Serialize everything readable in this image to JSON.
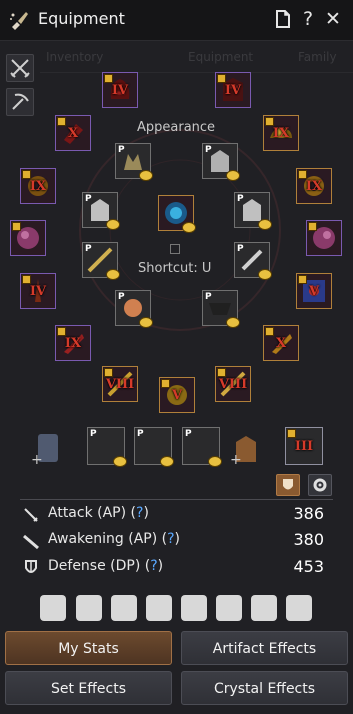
{
  "window": {
    "title": "Equipment",
    "icon": "brush-icon",
    "controls": [
      "document-icon",
      "help-icon",
      "close-icon"
    ],
    "help_glyph": "?",
    "close_glyph": "✕"
  },
  "background_tabs": [
    "Inventory",
    "",
    "Equipment",
    "Family"
  ],
  "labels": {
    "appearance": "Appearance",
    "shortcut": "Shortcut: U"
  },
  "slots": {
    "top_left": {
      "enhancement": "IV"
    },
    "top_right": {
      "enhancement": "IV"
    },
    "upper_left": {
      "enhancement": "X"
    },
    "upper_right": {
      "enhancement": "IX"
    },
    "mid_left": {
      "enhancement": "IX"
    },
    "mid_right": {
      "enhancement": "IX"
    },
    "low_left": {
      "enhancement": "IV"
    },
    "low_right": {
      "enhancement": "V"
    },
    "lower_left": {
      "enhancement": "IX"
    },
    "lower_right": {
      "enhancement": "X"
    },
    "bottom_left": {
      "enhancement": "VIII"
    },
    "bottom_center": {
      "enhancement": "V"
    },
    "bottom_right": {
      "enhancement": "VIII"
    },
    "tool_slot": {
      "enhancement": "III"
    }
  },
  "pet_marker": "+",
  "stats": [
    {
      "name": "Attack (AP)",
      "help": "?",
      "value": "386",
      "icon": "sword-icon"
    },
    {
      "name": "Awakening (AP)",
      "help": "?",
      "value": "380",
      "icon": "awakening-sword-icon"
    },
    {
      "name": "Defense (DP)",
      "help": "?",
      "value": "453",
      "icon": "shield-icon"
    }
  ],
  "life_skill_icons": [
    "gathering-icon",
    "fishing-icon",
    "hunting-icon",
    "training-icon",
    "trading-icon",
    "farming-icon",
    "sailing-icon",
    "defense-icon"
  ],
  "buttons": {
    "my_stats": "My Stats",
    "artifact_effects": "Artifact Effects",
    "set_effects": "Set Effects",
    "crystal_effects": "Crystal Effects"
  },
  "colors": {
    "accent_active": "#6c4a2e",
    "enhancement_text": "#d63a2a",
    "help_blue": "#5aa8ff",
    "slot_border_purple": "#7a5ab0",
    "slot_border_gold": "#b0803a"
  }
}
